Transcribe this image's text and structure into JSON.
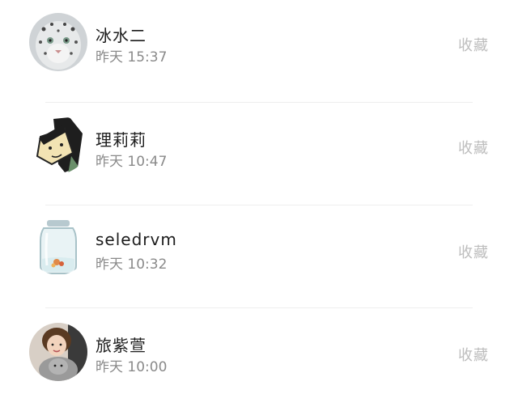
{
  "favorite_label": "收藏",
  "items": [
    {
      "name": "冰水二",
      "time": "昨天 15:37",
      "avatar": "snow-leopard"
    },
    {
      "name": "理莉莉",
      "time": "昨天 10:47",
      "avatar": "cartoon-character"
    },
    {
      "name": "seledrvm",
      "time": "昨天 10:32",
      "avatar": "glass-jar"
    },
    {
      "name": "旅紫萱",
      "time": "昨天 10:00",
      "avatar": "person-photo"
    }
  ]
}
